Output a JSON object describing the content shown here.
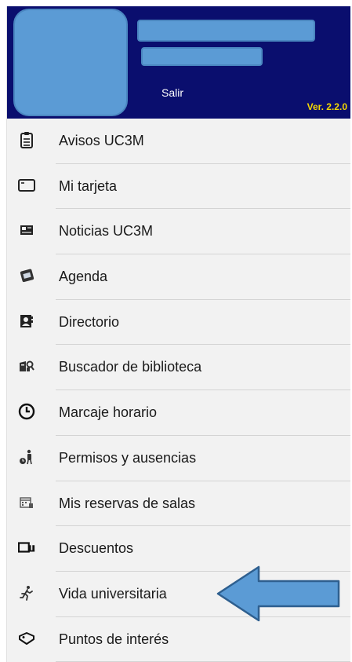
{
  "header": {
    "logout_label": "Salir",
    "version": "Ver. 2.2.0",
    "header_color": "#0a0e6e",
    "version_color": "#f5d800"
  },
  "menu": {
    "items": [
      {
        "label": "Avisos UC3M",
        "icon": "clipboard-icon"
      },
      {
        "label": "Mi tarjeta",
        "icon": "card-icon"
      },
      {
        "label": "Noticias UC3M",
        "icon": "newspaper-icon"
      },
      {
        "label": "Agenda",
        "icon": "calendar-icon"
      },
      {
        "label": "Directorio",
        "icon": "contacts-icon"
      },
      {
        "label": "Buscador de biblioteca",
        "icon": "library-search-icon"
      },
      {
        "label": "Marcaje horario",
        "icon": "clock-icon"
      },
      {
        "label": "Permisos y ausencias",
        "icon": "person-leave-icon"
      },
      {
        "label": "Mis reservas de salas",
        "icon": "room-booking-icon"
      },
      {
        "label": "Descuentos",
        "icon": "discount-icon"
      },
      {
        "label": "Vida universitaria",
        "icon": "runner-icon"
      },
      {
        "label": "Puntos de interés",
        "icon": "tag-icon"
      }
    ]
  },
  "annotation": {
    "pointer_color": "#5b9bd5",
    "pointer_icon": "left-arrow-icon"
  }
}
